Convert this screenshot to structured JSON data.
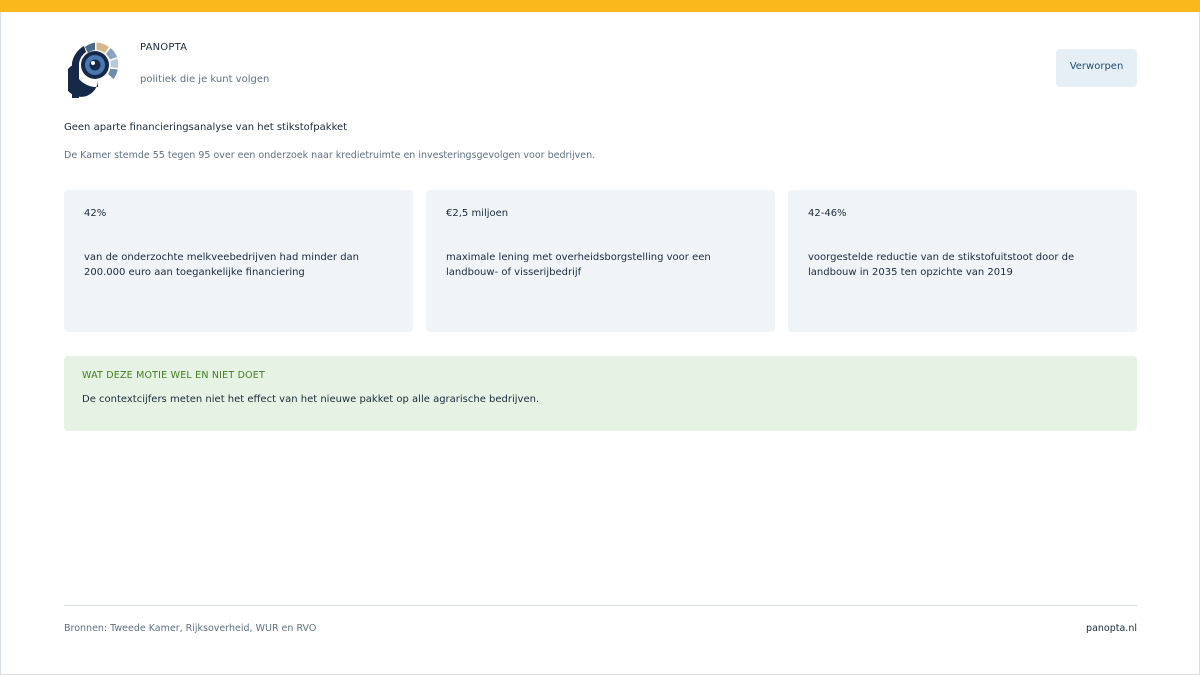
{
  "colors": {
    "accent_bar": "#fbb81d",
    "brand_navy": "#16294a",
    "card_bg": "#f0f4f7",
    "note_bg": "#e6f2e3",
    "note_title": "#3f7d1c",
    "status_bg": "#e6eff6"
  },
  "header": {
    "brand": "PANOPTA",
    "tagline": "politiek die je kunt volgen",
    "status_label": "Verworpen",
    "logo_icon": "eye-p-logo-icon"
  },
  "motion": {
    "title": "Geen aparte financieringsanalyse van het stikstofpakket",
    "summary": "De Kamer stemde 55 tegen 95 over een onderzoek naar kredietruimte en investeringsgevolgen voor bedrijven."
  },
  "stats": [
    {
      "value": "42%",
      "description": "van de onderzochte melkveebedrijven had minder dan 200.000 euro aan toegankelijke financiering"
    },
    {
      "value": "€2,5 miljoen",
      "description": "maximale lening met overheidsborgstelling voor een landbouw- of visserijbedrijf"
    },
    {
      "value": "42-46%",
      "description": "voorgestelde reductie van de stikstofuitstoot door de landbouw in 2035 ten opzichte van 2019"
    }
  ],
  "note": {
    "title": "WAT DEZE MOTIE WEL EN NIET DOET",
    "text": "De contextcijfers meten niet het effect van het nieuwe pakket op alle agrarische bedrijven."
  },
  "footer": {
    "sources": "Bronnen: Tweede Kamer, Rijksoverheid, WUR en RVO",
    "site": "panopta.nl"
  }
}
